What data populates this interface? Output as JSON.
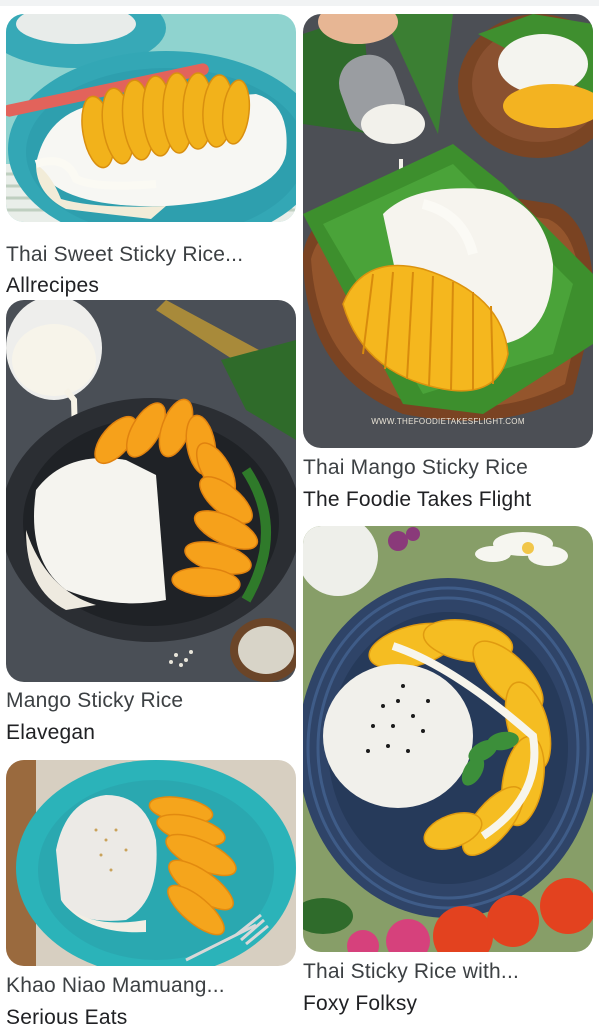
{
  "results": [
    {
      "title": "Thai Sweet Sticky Rice...",
      "source": "Allrecipes",
      "image_icon": "mango-sticky-rice-teal-plate-image"
    },
    {
      "title": "Thai Mango Sticky Rice",
      "source": "The Foodie Takes Flight",
      "image_icon": "mango-sticky-rice-wooden-plate-image",
      "watermark": "WWW.THEFOODIETAKESFLIGHT.COM"
    },
    {
      "title": "Mango Sticky Rice",
      "source": "Elavegan",
      "image_icon": "mango-sticky-rice-dark-bowl-image"
    },
    {
      "title": "Thai Sticky Rice with...",
      "source": "Foxy Folksy",
      "image_icon": "mango-sticky-rice-blue-plate-image"
    },
    {
      "title": "Khao Niao Mamuang...",
      "source": "Serious Eats",
      "image_icon": "mango-sticky-rice-turquoise-plate-image"
    }
  ],
  "colors": {
    "title_text": "#3c4043",
    "mango": "#f2b21b",
    "teal_plate": "#2fa3b4",
    "banana_leaf": "#3f8f2f"
  }
}
